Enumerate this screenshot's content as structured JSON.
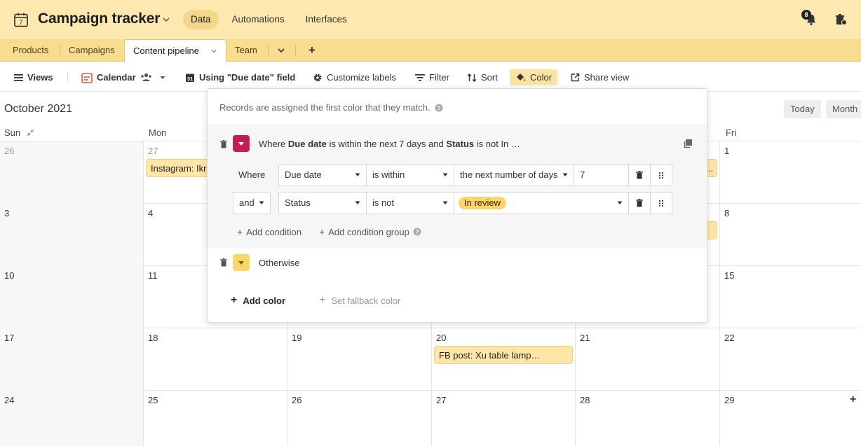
{
  "app": {
    "title": "Campaign tracker",
    "nav": [
      "Data",
      "Automations",
      "Interfaces"
    ],
    "notification_count": "8"
  },
  "tables": {
    "tabs": [
      "Products",
      "Campaigns",
      "Content pipeline",
      "Team"
    ],
    "add_label": "+"
  },
  "toolbar": {
    "views": "Views",
    "calendar": "Calendar",
    "date_field": "Using \"Due date\" field",
    "customize": "Customize labels",
    "filter": "Filter",
    "sort": "Sort",
    "color": "Color",
    "share": "Share view"
  },
  "calendar": {
    "month": "October 2021",
    "today": "Today",
    "month_btn": "Month",
    "days_of_week": {
      "sun": "Sun",
      "mon": "Mon",
      "fri": "Fri"
    },
    "weeks": [
      [
        "26",
        "27",
        "",
        "",
        "",
        "1",
        ""
      ],
      [
        "3",
        "4",
        "",
        "",
        "",
        "8",
        ""
      ],
      [
        "10",
        "11",
        "",
        "",
        "",
        "15",
        ""
      ],
      [
        "17",
        "18",
        "19",
        "20",
        "21",
        "22",
        ""
      ],
      [
        "24",
        "25",
        "26",
        "27",
        "28",
        "29",
        ""
      ]
    ],
    "events": {
      "instagram": "Instagram: Ikr",
      "fb_post": "FB post: Xu table lamp…",
      "partial_dots": ".."
    },
    "add_symbol": "+"
  },
  "color_popover": {
    "note": "Records are assigned the first color that they match.",
    "rule": {
      "summary_prefix": "Where",
      "summary_field1": "Due date",
      "summary_mid": "is within the next 7 days and",
      "summary_field2": "Status",
      "summary_suffix": "is not In …",
      "swatch_color": "#c21f4d"
    },
    "conditions": [
      {
        "conj": "Where",
        "field": "Due date",
        "op": "is within",
        "value": "the next number of days",
        "extra": "7"
      },
      {
        "conj": "and",
        "field": "Status",
        "op": "is not",
        "value": "In review"
      }
    ],
    "add_condition": "Add condition",
    "add_condition_group": "Add condition group",
    "otherwise": "Otherwise",
    "otherwise_color": "#fcd56a",
    "add_color": "Add color",
    "set_fallback": "Set fallback color"
  }
}
